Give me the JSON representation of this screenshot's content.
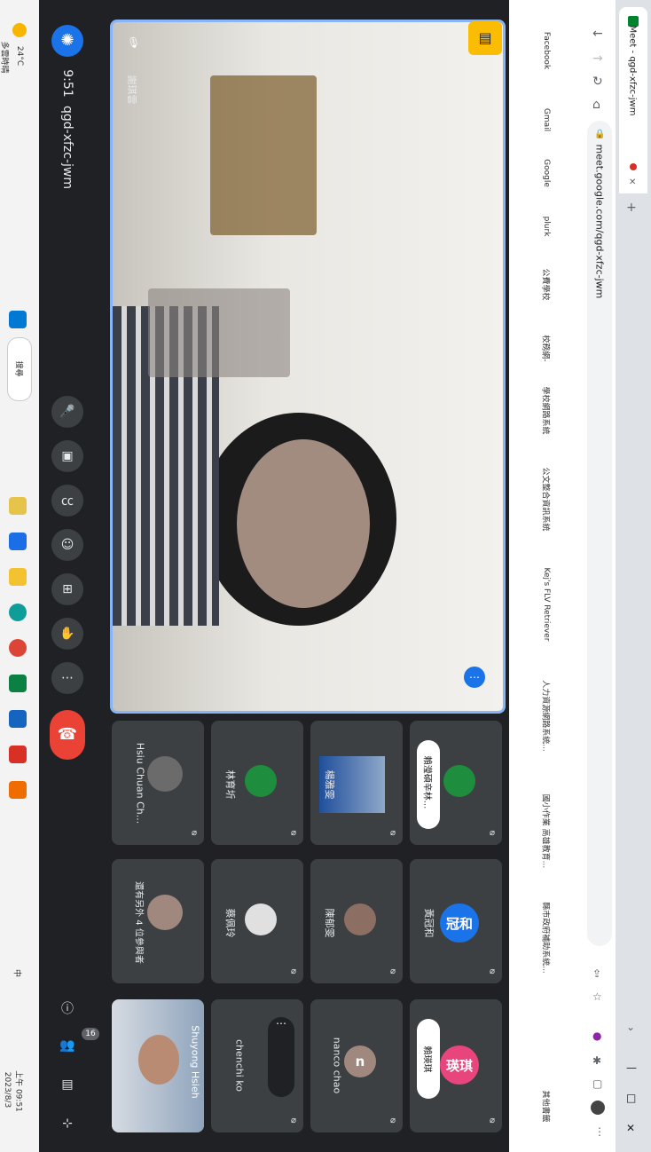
{
  "taskbar": {
    "weather_temp": "24°C",
    "weather_desc": "多雲時晴",
    "search_label": "搜尋",
    "clock_time": "上午 09:51",
    "clock_date": "2023/8/3",
    "ime": "中"
  },
  "meet": {
    "time": "9:51",
    "meeting_code": "qgd-xfzc-jwm",
    "participant_count": "16",
    "speaker_name": "謝琪雲",
    "tiles": [
      {
        "name": "Hsiu Chuan Ch...",
        "avatar_text": ""
      },
      {
        "name": "林育圻",
        "avatar_text": ""
      },
      {
        "name": "楊雅雯",
        "avatar_text": ""
      },
      {
        "name": "賴瀅碩辛林...",
        "avatar_text": ""
      },
      {
        "name": "還有另外 4 位參與者",
        "avatar_text": ""
      },
      {
        "name": "蔡佩玲",
        "avatar_text": ""
      },
      {
        "name": "陳郁雯",
        "avatar_text": ""
      },
      {
        "name": "黃冠和",
        "avatar_text": "冠和"
      },
      {
        "name": "Shuyong Hsieh",
        "avatar_text": ""
      },
      {
        "name": "chenchi ko",
        "avatar_text": ""
      },
      {
        "name": "nanco chao",
        "avatar_text": "n"
      },
      {
        "name": "賴瑛琪",
        "avatar_text": "瑛琪"
      }
    ]
  },
  "browser": {
    "tab_title": "Meet - qgd-xfzc-jwm",
    "url": "meet.google.com/qgd-xfzc-jwm",
    "bookmarks": [
      "Facebook",
      "Gmail",
      "Google",
      "plurk",
      "公費學校",
      "校務網-",
      "學校網路系統",
      "公文整合資訊系統",
      "Kej's FLV Retriever",
      "人力資源網路系統...",
      "國小作業 高雄教育...",
      "縣市政府補助系統...",
      "其他書籤"
    ]
  },
  "colors": {
    "meet_bg": "#202124",
    "tile_bg": "#3c4043",
    "end_call": "#ea4335",
    "active_border": "#8ab4f8",
    "avatar_green": "#1e8e3e",
    "avatar_blue": "#1a73e8",
    "avatar_pink": "#e8457c",
    "avatar_brown": "#a1887f",
    "activities_yellow": "#fbbc04"
  },
  "icons": [
    "mic-off-icon",
    "camera-off-icon",
    "captions-icon",
    "emoji-icon",
    "present-icon",
    "raise-hand-icon",
    "more-options-icon",
    "end-call-icon",
    "info-icon",
    "people-icon",
    "chat-icon",
    "activities-icon"
  ]
}
